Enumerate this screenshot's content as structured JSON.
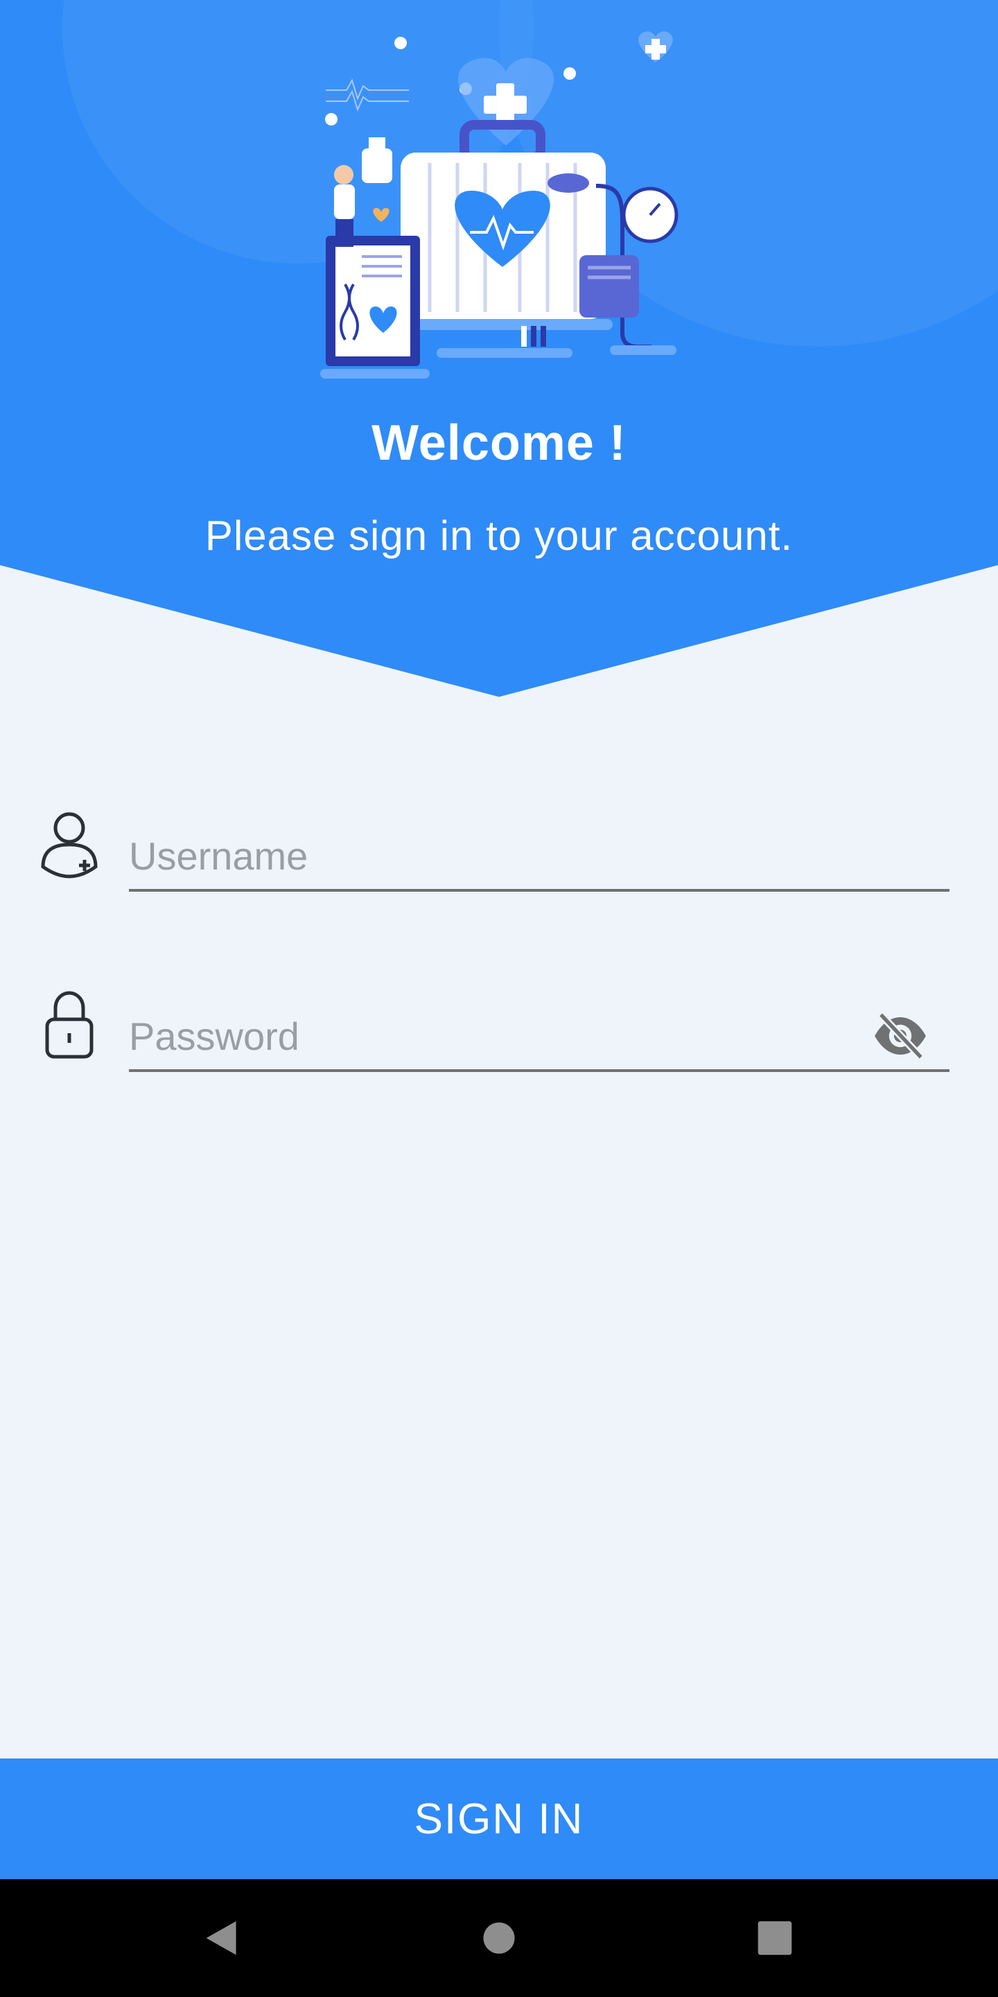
{
  "header": {
    "welcome": "Welcome !",
    "subtitle": "Please sign in to your account.",
    "illustration_icon": "medical-kit-illustration"
  },
  "form": {
    "username": {
      "placeholder": "Username",
      "value": "",
      "icon": "user-icon"
    },
    "password": {
      "placeholder": "Password",
      "value": "",
      "icon": "lock-icon",
      "toggle_icon": "eye-off-icon"
    }
  },
  "signin_button": {
    "label": "SIGN IN"
  },
  "navbar": {
    "back_icon": "back-triangle-icon",
    "home_icon": "home-circle-icon",
    "recents_icon": "recents-square-icon"
  },
  "colors": {
    "primary": "#2f8bf7",
    "background": "#eef4f9",
    "text_light": "#ffffff",
    "placeholder": "#9a9ea3",
    "underline": "#6f7173",
    "navbar": "#000000"
  }
}
